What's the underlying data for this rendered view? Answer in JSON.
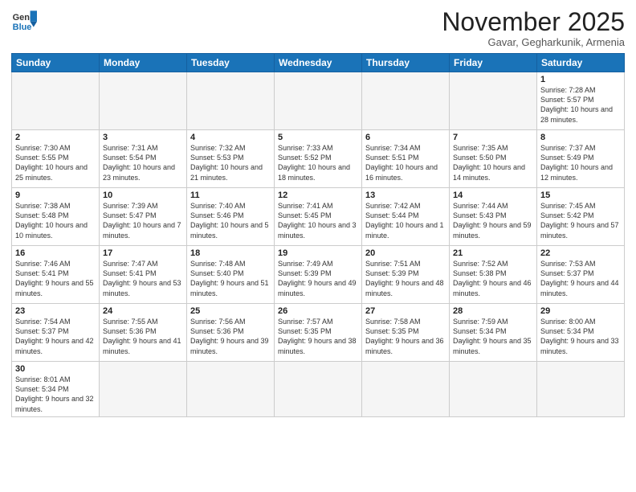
{
  "logo": {
    "line1": "General",
    "line2": "Blue"
  },
  "header": {
    "month_title": "November 2025",
    "subtitle": "Gavar, Gegharkunik, Armenia"
  },
  "weekdays": [
    "Sunday",
    "Monday",
    "Tuesday",
    "Wednesday",
    "Thursday",
    "Friday",
    "Saturday"
  ],
  "days": [
    {
      "num": "",
      "info": ""
    },
    {
      "num": "",
      "info": ""
    },
    {
      "num": "",
      "info": ""
    },
    {
      "num": "",
      "info": ""
    },
    {
      "num": "",
      "info": ""
    },
    {
      "num": "",
      "info": ""
    },
    {
      "num": "1",
      "info": "Sunrise: 7:28 AM\nSunset: 5:57 PM\nDaylight: 10 hours and 28 minutes."
    },
    {
      "num": "2",
      "info": "Sunrise: 7:30 AM\nSunset: 5:55 PM\nDaylight: 10 hours and 25 minutes."
    },
    {
      "num": "3",
      "info": "Sunrise: 7:31 AM\nSunset: 5:54 PM\nDaylight: 10 hours and 23 minutes."
    },
    {
      "num": "4",
      "info": "Sunrise: 7:32 AM\nSunset: 5:53 PM\nDaylight: 10 hours and 21 minutes."
    },
    {
      "num": "5",
      "info": "Sunrise: 7:33 AM\nSunset: 5:52 PM\nDaylight: 10 hours and 18 minutes."
    },
    {
      "num": "6",
      "info": "Sunrise: 7:34 AM\nSunset: 5:51 PM\nDaylight: 10 hours and 16 minutes."
    },
    {
      "num": "7",
      "info": "Sunrise: 7:35 AM\nSunset: 5:50 PM\nDaylight: 10 hours and 14 minutes."
    },
    {
      "num": "8",
      "info": "Sunrise: 7:37 AM\nSunset: 5:49 PM\nDaylight: 10 hours and 12 minutes."
    },
    {
      "num": "9",
      "info": "Sunrise: 7:38 AM\nSunset: 5:48 PM\nDaylight: 10 hours and 10 minutes."
    },
    {
      "num": "10",
      "info": "Sunrise: 7:39 AM\nSunset: 5:47 PM\nDaylight: 10 hours and 7 minutes."
    },
    {
      "num": "11",
      "info": "Sunrise: 7:40 AM\nSunset: 5:46 PM\nDaylight: 10 hours and 5 minutes."
    },
    {
      "num": "12",
      "info": "Sunrise: 7:41 AM\nSunset: 5:45 PM\nDaylight: 10 hours and 3 minutes."
    },
    {
      "num": "13",
      "info": "Sunrise: 7:42 AM\nSunset: 5:44 PM\nDaylight: 10 hours and 1 minute."
    },
    {
      "num": "14",
      "info": "Sunrise: 7:44 AM\nSunset: 5:43 PM\nDaylight: 9 hours and 59 minutes."
    },
    {
      "num": "15",
      "info": "Sunrise: 7:45 AM\nSunset: 5:42 PM\nDaylight: 9 hours and 57 minutes."
    },
    {
      "num": "16",
      "info": "Sunrise: 7:46 AM\nSunset: 5:41 PM\nDaylight: 9 hours and 55 minutes."
    },
    {
      "num": "17",
      "info": "Sunrise: 7:47 AM\nSunset: 5:41 PM\nDaylight: 9 hours and 53 minutes."
    },
    {
      "num": "18",
      "info": "Sunrise: 7:48 AM\nSunset: 5:40 PM\nDaylight: 9 hours and 51 minutes."
    },
    {
      "num": "19",
      "info": "Sunrise: 7:49 AM\nSunset: 5:39 PM\nDaylight: 9 hours and 49 minutes."
    },
    {
      "num": "20",
      "info": "Sunrise: 7:51 AM\nSunset: 5:39 PM\nDaylight: 9 hours and 48 minutes."
    },
    {
      "num": "21",
      "info": "Sunrise: 7:52 AM\nSunset: 5:38 PM\nDaylight: 9 hours and 46 minutes."
    },
    {
      "num": "22",
      "info": "Sunrise: 7:53 AM\nSunset: 5:37 PM\nDaylight: 9 hours and 44 minutes."
    },
    {
      "num": "23",
      "info": "Sunrise: 7:54 AM\nSunset: 5:37 PM\nDaylight: 9 hours and 42 minutes."
    },
    {
      "num": "24",
      "info": "Sunrise: 7:55 AM\nSunset: 5:36 PM\nDaylight: 9 hours and 41 minutes."
    },
    {
      "num": "25",
      "info": "Sunrise: 7:56 AM\nSunset: 5:36 PM\nDaylight: 9 hours and 39 minutes."
    },
    {
      "num": "26",
      "info": "Sunrise: 7:57 AM\nSunset: 5:35 PM\nDaylight: 9 hours and 38 minutes."
    },
    {
      "num": "27",
      "info": "Sunrise: 7:58 AM\nSunset: 5:35 PM\nDaylight: 9 hours and 36 minutes."
    },
    {
      "num": "28",
      "info": "Sunrise: 7:59 AM\nSunset: 5:34 PM\nDaylight: 9 hours and 35 minutes."
    },
    {
      "num": "29",
      "info": "Sunrise: 8:00 AM\nSunset: 5:34 PM\nDaylight: 9 hours and 33 minutes."
    },
    {
      "num": "30",
      "info": "Sunrise: 8:01 AM\nSunset: 5:34 PM\nDaylight: 9 hours and 32 minutes."
    },
    {
      "num": "",
      "info": ""
    },
    {
      "num": "",
      "info": ""
    },
    {
      "num": "",
      "info": ""
    },
    {
      "num": "",
      "info": ""
    },
    {
      "num": "",
      "info": ""
    },
    {
      "num": "",
      "info": ""
    }
  ]
}
